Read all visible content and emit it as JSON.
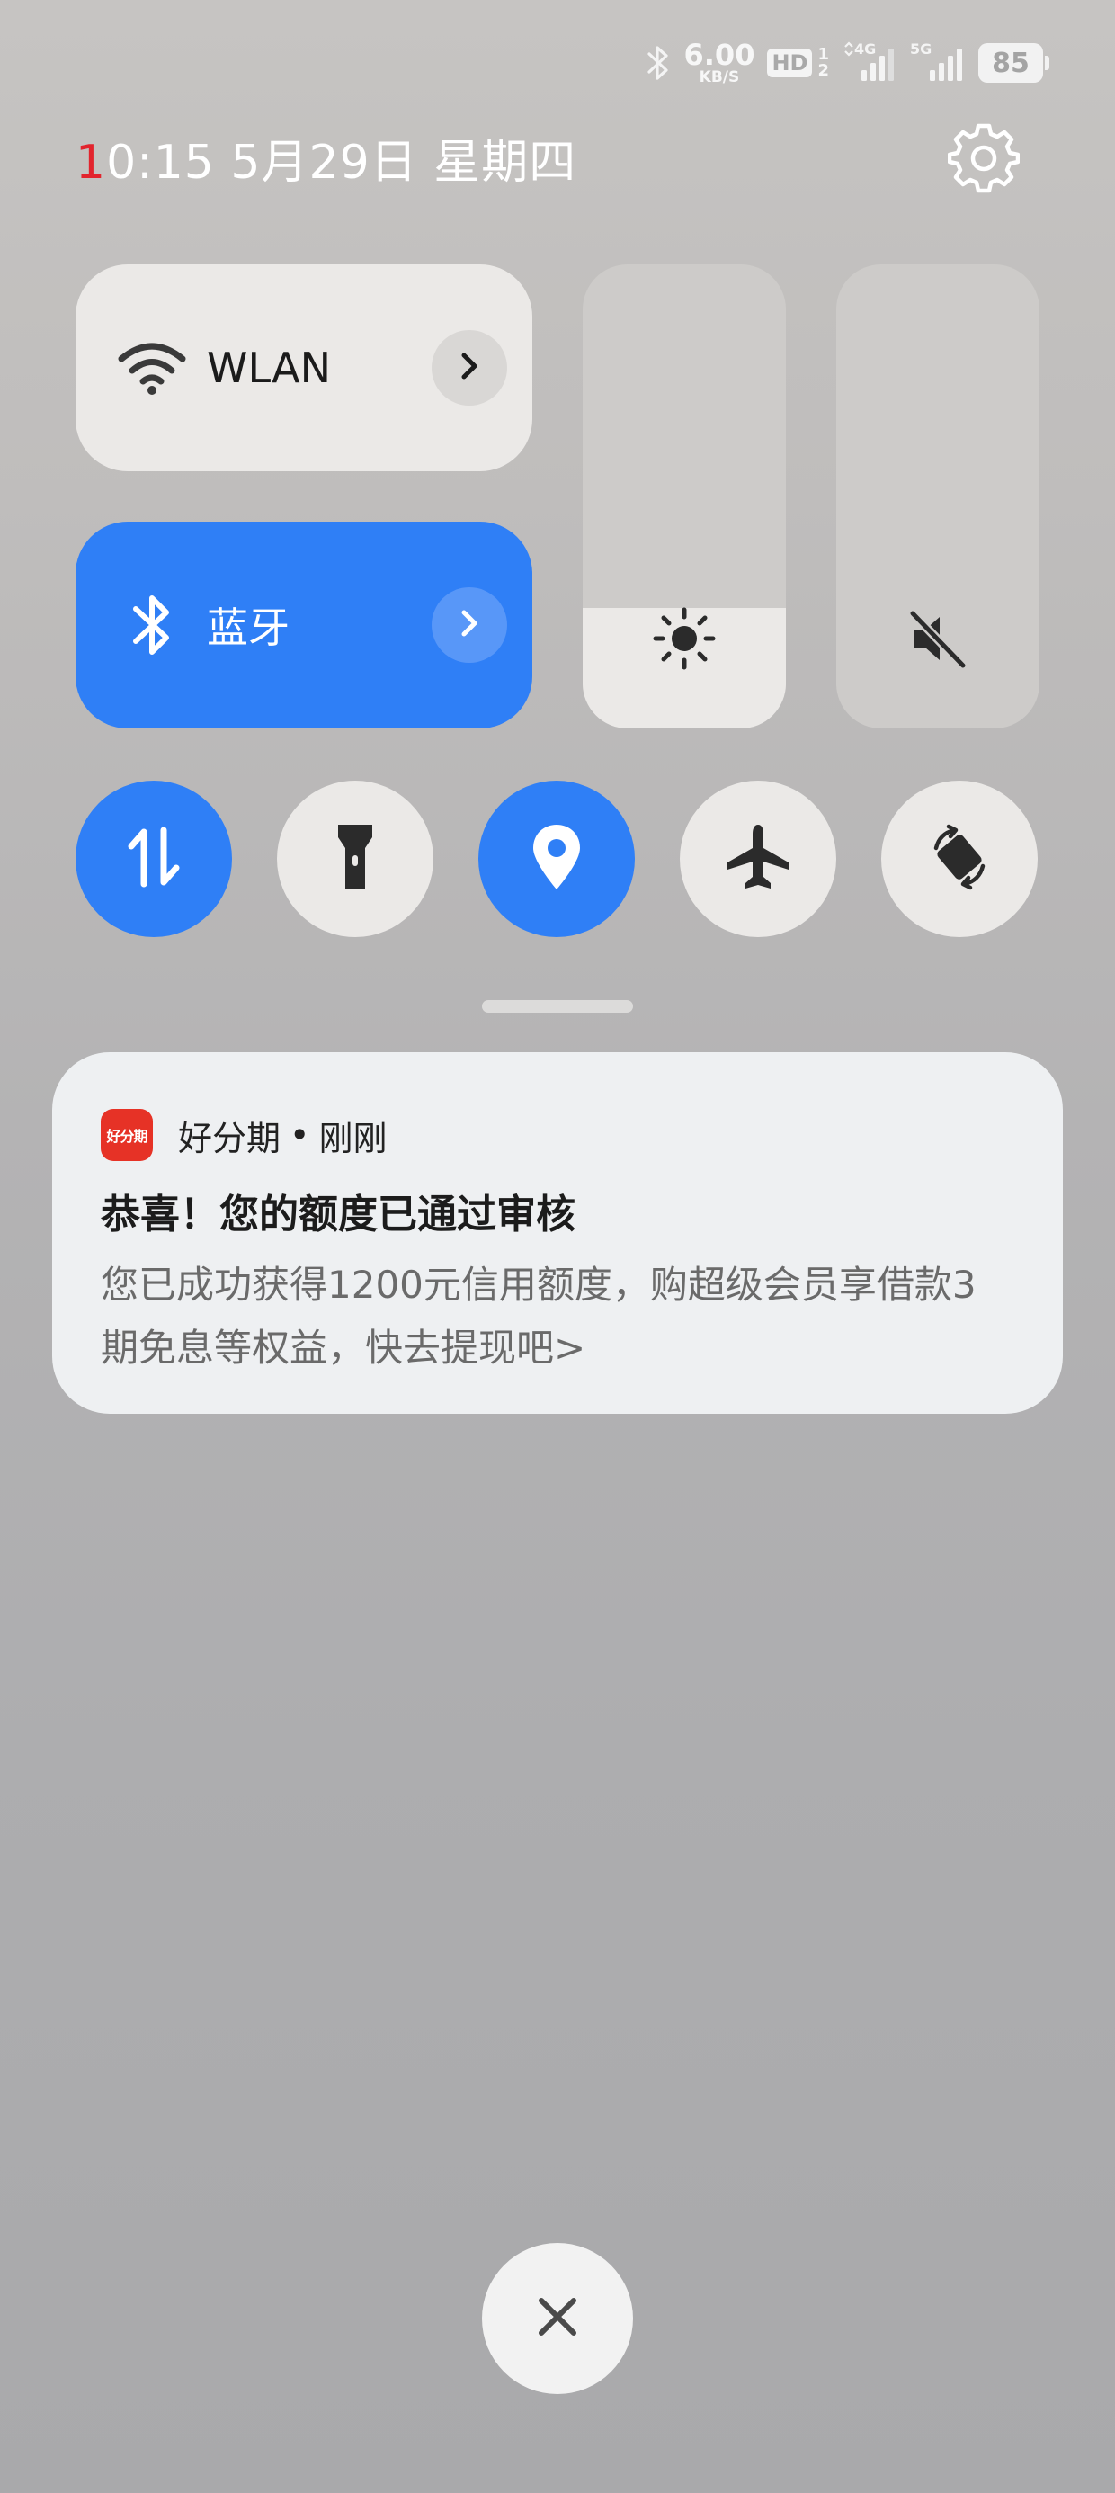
{
  "status_bar": {
    "net_speed_value": "6.00",
    "net_speed_unit": "KB/S",
    "hd_badge": "HD",
    "sim_slot_top": "1",
    "sim_slot_bottom": "2",
    "network_1": "4G",
    "network_2": "5G",
    "battery_level": "85",
    "icons": [
      "bluetooth-icon",
      "signal-icon",
      "signal-icon"
    ]
  },
  "header": {
    "time_first_digit": "1",
    "time_rest": "0:15",
    "date": "5月29日",
    "weekday": "星期四"
  },
  "tiles": {
    "wlan": {
      "label": "WLAN",
      "active": false
    },
    "bluetooth": {
      "label": "蓝牙",
      "active": true
    }
  },
  "sliders": {
    "brightness": {
      "level": 0.26,
      "icon": "brightness-icon"
    },
    "volume": {
      "level": 0.0,
      "icon": "mute-icon"
    }
  },
  "toggles": [
    {
      "name": "mobile-data",
      "icon": "data-transfer-icon",
      "active": true
    },
    {
      "name": "flashlight",
      "icon": "flashlight-icon",
      "active": false
    },
    {
      "name": "location",
      "icon": "location-icon",
      "active": true
    },
    {
      "name": "airplane-mode",
      "icon": "airplane-icon",
      "active": false
    },
    {
      "name": "auto-rotate",
      "icon": "rotate-icon",
      "active": false
    }
  ],
  "notification": {
    "app_icon_text": "好分期",
    "app_name": "好分期",
    "separator": "•",
    "time": "刚刚",
    "title": "恭喜！您的额度已通过审核",
    "body": "您已成功获得1200元信用额度，购超级会员享借款3期免息等权益，快去提现吧>"
  },
  "colors": {
    "accent_blue": "#2f7ff6",
    "tile_light": "#ebe9e7",
    "time_first_digit": "#e2242d",
    "app_icon_red": "#e63226"
  }
}
